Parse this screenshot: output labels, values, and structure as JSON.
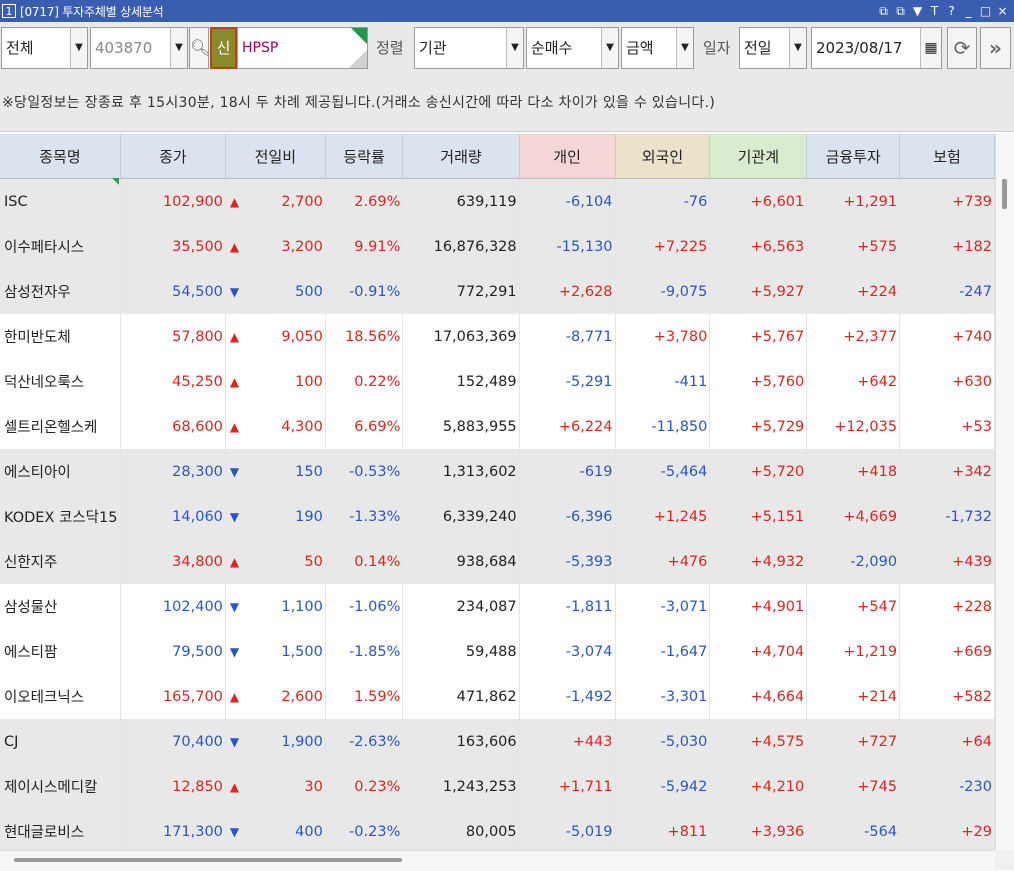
{
  "window": {
    "number": "1",
    "title": "[0717] 투자주체별 상세분석",
    "controls": [
      "⧉",
      "⧉",
      "▼",
      "T",
      "?",
      "_",
      "□",
      "×"
    ]
  },
  "toolbar": {
    "market": "전체",
    "code": "403870",
    "new_badge": "신",
    "stock_name": "HPSP",
    "sort_label": "정렬",
    "sort_by": "기관",
    "qty_type": "순매수",
    "unit_type": "금액",
    "date_label": "일자",
    "date_mode": "전일",
    "date": "2023/08/17",
    "colors": {
      "accent_badge": "#8a8a2a",
      "badge_border": "#b8451a",
      "stock_name": "#a0005a"
    }
  },
  "notice": "※당일정보는 장종료 후 15시30분, 18시 두 차례 제공됩니다.(거래소 송신시간에 따라 다소 차이가 있을 수 있습니다.)",
  "table": {
    "headers": [
      "종목명",
      "종가",
      "전일비",
      "등락률",
      "거래량",
      "개인",
      "외국인",
      "기관계",
      "금융투자",
      "보험"
    ],
    "rows": [
      {
        "name": "ISC",
        "price": "102,900",
        "dir": "up",
        "chg": "2,700",
        "rate": "2.69%",
        "vol": "639,119",
        "ind": "-6,104",
        "for": "-76",
        "ins": "+6,601",
        "fin": "+1,291",
        "insu": "+739"
      },
      {
        "name": "이수페타시스",
        "price": "35,500",
        "dir": "up",
        "chg": "3,200",
        "rate": "9.91%",
        "vol": "16,876,328",
        "ind": "-15,130",
        "for": "+7,225",
        "ins": "+6,563",
        "fin": "+575",
        "insu": "+182"
      },
      {
        "name": "삼성전자우",
        "price": "54,500",
        "dir": "down",
        "chg": "500",
        "rate": "-0.91%",
        "vol": "772,291",
        "ind": "+2,628",
        "for": "-9,075",
        "ins": "+5,927",
        "fin": "+224",
        "insu": "-247"
      },
      {
        "name": "한미반도체",
        "price": "57,800",
        "dir": "up",
        "chg": "9,050",
        "rate": "18.56%",
        "vol": "17,063,369",
        "ind": "-8,771",
        "for": "+3,780",
        "ins": "+5,767",
        "fin": "+2,377",
        "insu": "+740"
      },
      {
        "name": "덕산네오룩스",
        "price": "45,250",
        "dir": "up",
        "chg": "100",
        "rate": "0.22%",
        "vol": "152,489",
        "ind": "-5,291",
        "for": "-411",
        "ins": "+5,760",
        "fin": "+642",
        "insu": "+630"
      },
      {
        "name": "셀트리온헬스케",
        "price": "68,600",
        "dir": "up",
        "chg": "4,300",
        "rate": "6.69%",
        "vol": "5,883,955",
        "ind": "+6,224",
        "for": "-11,850",
        "ins": "+5,729",
        "fin": "+12,035",
        "insu": "+53"
      },
      {
        "name": "에스티아이",
        "price": "28,300",
        "dir": "down",
        "chg": "150",
        "rate": "-0.53%",
        "vol": "1,313,602",
        "ind": "-619",
        "for": "-5,464",
        "ins": "+5,720",
        "fin": "+418",
        "insu": "+342"
      },
      {
        "name": "KODEX 코스닥15",
        "price": "14,060",
        "dir": "down",
        "chg": "190",
        "rate": "-1.33%",
        "vol": "6,339,240",
        "ind": "-6,396",
        "for": "+1,245",
        "ins": "+5,151",
        "fin": "+4,669",
        "insu": "-1,732"
      },
      {
        "name": "신한지주",
        "price": "34,800",
        "dir": "up",
        "chg": "50",
        "rate": "0.14%",
        "vol": "938,684",
        "ind": "-5,393",
        "for": "+476",
        "ins": "+4,932",
        "fin": "-2,090",
        "insu": "+439"
      },
      {
        "name": "삼성물산",
        "price": "102,400",
        "dir": "down",
        "chg": "1,100",
        "rate": "-1.06%",
        "vol": "234,087",
        "ind": "-1,811",
        "for": "-3,071",
        "ins": "+4,901",
        "fin": "+547",
        "insu": "+228"
      },
      {
        "name": "에스티팜",
        "price": "79,500",
        "dir": "down",
        "chg": "1,500",
        "rate": "-1.85%",
        "vol": "59,488",
        "ind": "-3,074",
        "for": "-1,647",
        "ins": "+4,704",
        "fin": "+1,219",
        "insu": "+669"
      },
      {
        "name": "이오테크닉스",
        "price": "165,700",
        "dir": "up",
        "chg": "2,600",
        "rate": "1.59%",
        "vol": "471,862",
        "ind": "-1,492",
        "for": "-3,301",
        "ins": "+4,664",
        "fin": "+214",
        "insu": "+582"
      },
      {
        "name": "CJ",
        "price": "70,400",
        "dir": "down",
        "chg": "1,900",
        "rate": "-2.63%",
        "vol": "163,606",
        "ind": "+443",
        "for": "-5,030",
        "ins": "+4,575",
        "fin": "+727",
        "insu": "+64"
      },
      {
        "name": "제이시스메디칼",
        "price": "12,850",
        "dir": "up",
        "chg": "30",
        "rate": "0.23%",
        "vol": "1,243,253",
        "ind": "+1,711",
        "for": "-5,942",
        "ins": "+4,210",
        "fin": "+745",
        "insu": "-230"
      },
      {
        "name": "현대글로비스",
        "price": "171,300",
        "dir": "down",
        "chg": "400",
        "rate": "-0.23%",
        "vol": "80,005",
        "ind": "-5,019",
        "for": "+811",
        "ins": "+3,936",
        "fin": "-564",
        "insu": "+29"
      }
    ]
  },
  "colors": {
    "up": "#e1231e",
    "down": "#2a55c8",
    "header_individual": "#f5d6d6",
    "header_foreign": "#ece2cc",
    "header_institution": "#d9ecd0",
    "titlebar": "#3b5db1"
  }
}
